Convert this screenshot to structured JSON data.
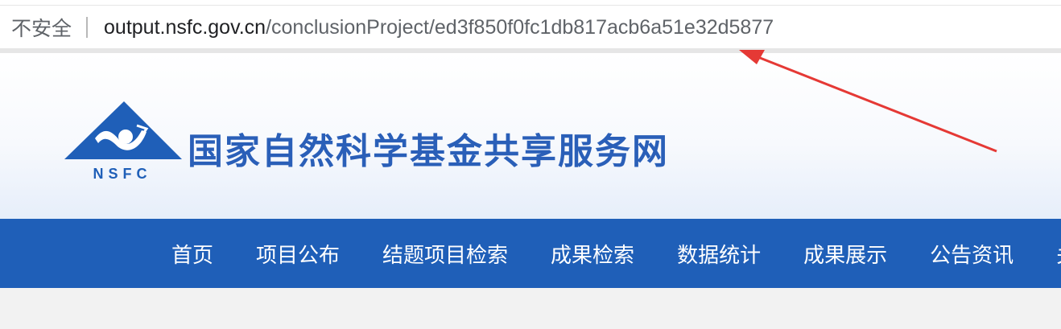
{
  "browser": {
    "security_label": "不安全",
    "url_host": "output.nsfc.gov.cn",
    "url_path": "/conclusionProject/ed3f850f0fc1db817acb6a51e32d5877"
  },
  "header": {
    "logo_text": "NSFC",
    "site_title": "国家自然科学基金共享服务网"
  },
  "nav": {
    "items": [
      {
        "label": "首页"
      },
      {
        "label": "项目公布"
      },
      {
        "label": "结题项目检索"
      },
      {
        "label": "成果检索"
      },
      {
        "label": "数据统计"
      },
      {
        "label": "成果展示"
      },
      {
        "label": "公告资讯"
      },
      {
        "label": "关"
      }
    ]
  },
  "colors": {
    "nav_background": "#1f5fb8",
    "title_blue": "#2a5fb8",
    "annotation_arrow": "#e53935"
  }
}
